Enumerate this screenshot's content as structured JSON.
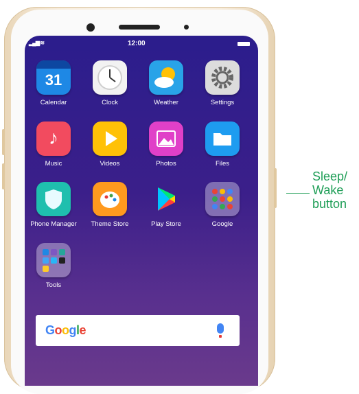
{
  "status_bar": {
    "time": "12:00"
  },
  "apps": [
    {
      "label": "Calendar",
      "icon": "calendar-icon",
      "day": "31"
    },
    {
      "label": "Clock",
      "icon": "clock-icon"
    },
    {
      "label": "Weather",
      "icon": "weather-icon"
    },
    {
      "label": "Settings",
      "icon": "gear-icon"
    },
    {
      "label": "Music",
      "icon": "music-note-icon"
    },
    {
      "label": "Videos",
      "icon": "play-icon"
    },
    {
      "label": "Photos",
      "icon": "photo-icon"
    },
    {
      "label": "Files",
      "icon": "folder-icon"
    },
    {
      "label": "Phone Manager",
      "icon": "shield-icon"
    },
    {
      "label": "Theme Store",
      "icon": "palette-icon"
    },
    {
      "label": "Play Store",
      "icon": "play-store-icon"
    },
    {
      "label": "Google",
      "icon": "folder-grid-icon"
    },
    {
      "label": "Tools",
      "icon": "folder-grid-icon"
    }
  ],
  "search_bar": {
    "logo": "Google",
    "mic_icon": "microphone-icon"
  },
  "callout": {
    "line1": "Sleep/",
    "line2": "Wake",
    "line3": "button"
  },
  "colors": {
    "callout": "#1f9e57",
    "screen_top": "#2b1d8c",
    "screen_bottom": "#6a3a8c"
  }
}
